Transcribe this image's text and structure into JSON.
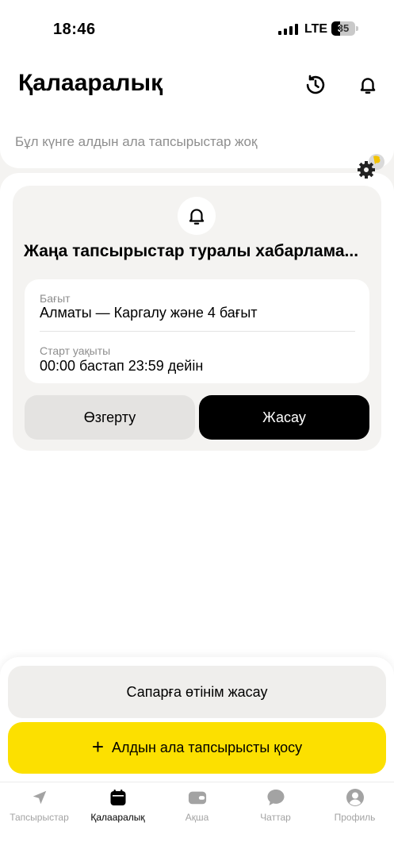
{
  "status_bar": {
    "time": "18:46",
    "network": "LTE",
    "battery": "35",
    "battery_level": 0.35
  },
  "header": {
    "title": "Қалааралық",
    "history_icon": "history-icon",
    "bell_icon": "bell-icon"
  },
  "empty_state": {
    "text": "Бұл күнге алдын ала тапсырыстар жоқ"
  },
  "notification_card": {
    "title": "Жаңа тапсырыстар туралы хабарлама...",
    "route_label": "Бағыт",
    "route_value": "Алматы — Каргалу және 4 бағыт",
    "start_label": "Старт уақыты",
    "start_value": "00:00 бастап 23:59 дейін",
    "edit_label": "Өзгерту",
    "create_label": "Жасау"
  },
  "bottom_actions": {
    "request_label": "Сапарға өтінім жасау",
    "add_label": "Алдын ала тапсырысты қосу",
    "add_color": "#fce000"
  },
  "tabs": [
    {
      "label": "Тапсырыстар",
      "icon": "navigation-arrow-icon",
      "active": false
    },
    {
      "label": "Қалааралық",
      "icon": "calendar-icon",
      "active": true
    },
    {
      "label": "Ақша",
      "icon": "wallet-icon",
      "active": false
    },
    {
      "label": "Чаттар",
      "icon": "chat-bubble-icon",
      "active": false
    },
    {
      "label": "Профиль",
      "icon": "profile-icon",
      "active": false
    }
  ]
}
